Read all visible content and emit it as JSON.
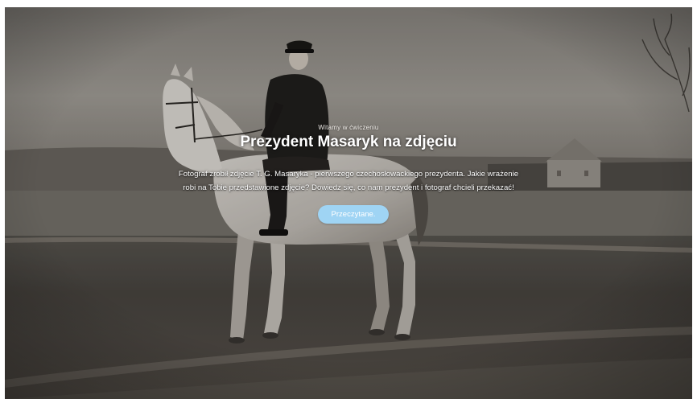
{
  "hero": {
    "eyebrow": "Witamy w ćwiczeniu",
    "title": "Prezydent Masaryk na zdjęciu",
    "description": "Fotograf zrobił zdjęcie T. G. Masaryka - pierwszego czechosłowackiego prezydenta. Jakie wrażenie robi na Tobie przedstawione zdjęcie? Dowiedz się, co nam prezydent i fotograf chcieli przekazać!",
    "button_label": "Przeczytane."
  },
  "colors": {
    "button_bg": "#9fd4f4",
    "text": "#ffffff"
  }
}
